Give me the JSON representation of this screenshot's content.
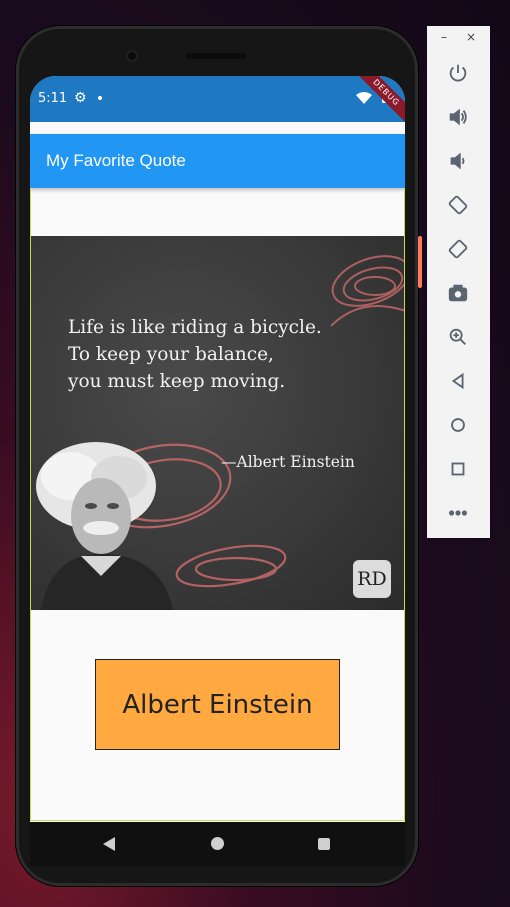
{
  "status_bar": {
    "time": "5:11",
    "debug_label": "DEBUG"
  },
  "app_bar": {
    "title": "My Favorite Quote"
  },
  "quote_image": {
    "lines": [
      "Life is like riding a bicycle.",
      "To keep your balance,",
      "you must keep moving."
    ],
    "author": "—Albert Einstein",
    "logo_text": "RD"
  },
  "button": {
    "label": "Albert Einstein"
  },
  "emulator_panel": {
    "minimize": "–",
    "close": "×",
    "controls": [
      "power-icon",
      "volume-up-icon",
      "volume-down-icon",
      "rotate-left-icon",
      "rotate-right-icon",
      "camera-icon",
      "zoom-icon",
      "back-icon",
      "home-icon",
      "overview-icon",
      "more-icon"
    ]
  },
  "colors": {
    "status_bar": "#1e78c2",
    "app_bar": "#2196f3",
    "button": "#ffa940"
  }
}
